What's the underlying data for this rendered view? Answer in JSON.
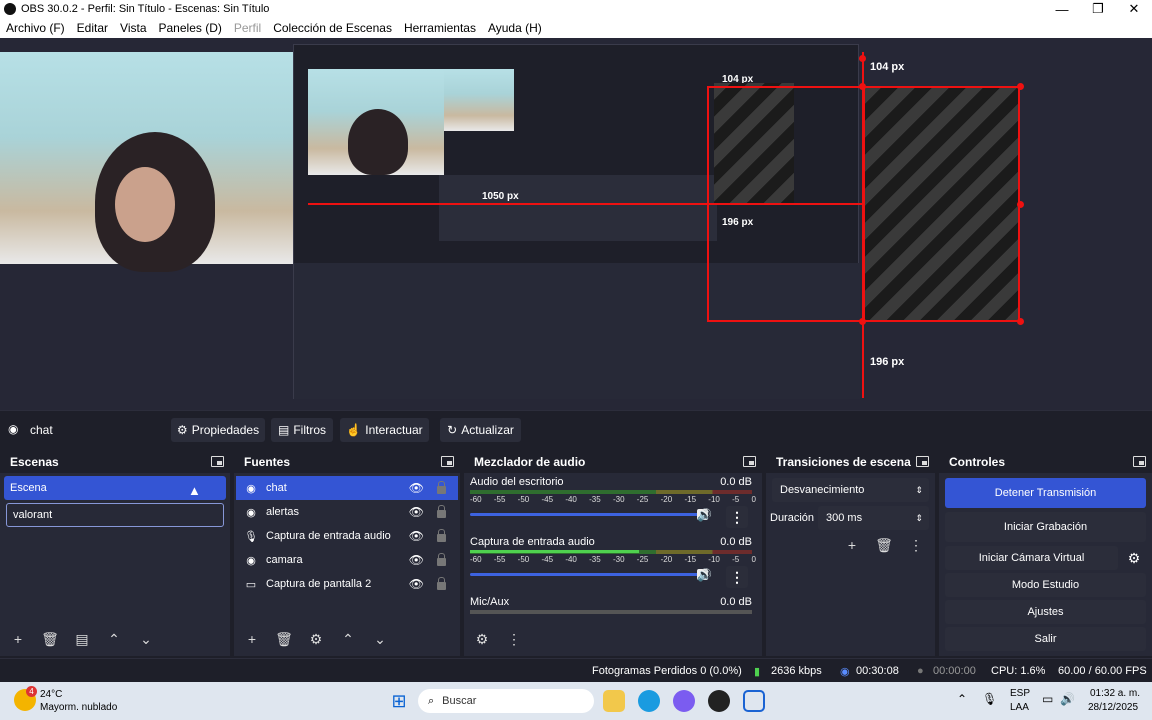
{
  "titlebar": {
    "title": "OBS 30.0.2 - Perfil: Sin Título - Escenas: Sin Título",
    "minimize": "—",
    "maximize": "❐",
    "close": "✕"
  },
  "menu": {
    "items": [
      "Archivo (F)",
      "Editar",
      "Vista",
      "Paneles (D)",
      "Perfil",
      "Colección de Escenas",
      "Herramientas",
      "Ayuda (H)"
    ]
  },
  "preview": {
    "label_top": "104 px",
    "label_right": "196 px",
    "nested_label": "1050 px",
    "nested_label2": "196 px",
    "nested_label3": "104 px"
  },
  "source_toolbar": {
    "current_source": "chat",
    "properties": "Propiedades",
    "filters": "Filtros",
    "interact": "Interactuar",
    "refresh": "Actualizar"
  },
  "scenes": {
    "title": "Escenas",
    "items": [
      "Escena",
      "valorant"
    ]
  },
  "sources": {
    "title": "Fuentes",
    "items": [
      {
        "name": "chat",
        "icon": "browser-icon"
      },
      {
        "name": "alertas",
        "icon": "browser-icon"
      },
      {
        "name": "Captura de entrada audio",
        "icon": "mic-icon"
      },
      {
        "name": "camara",
        "icon": "browser-icon"
      },
      {
        "name": "Captura de pantalla 2",
        "icon": "monitor-icon"
      }
    ]
  },
  "mixer": {
    "title": "Mezclador de audio",
    "scale": [
      "-60",
      "-55",
      "-50",
      "-45",
      "-40",
      "-35",
      "-30",
      "-25",
      "-20",
      "-15",
      "-10",
      "-5",
      "0"
    ],
    "channels": [
      {
        "name": "Audio del escritorio",
        "db": "0.0 dB"
      },
      {
        "name": "Captura de entrada audio",
        "db": "0.0 dB"
      },
      {
        "name": "Mic/Aux",
        "db": "0.0 dB"
      }
    ]
  },
  "transitions": {
    "title": "Transiciones de escena",
    "selected": "Desvanecimiento",
    "duration_label": "Duración",
    "duration_value": "300 ms"
  },
  "controls": {
    "title": "Controles",
    "stop_stream": "Detener Transmisión",
    "start_recording": "Iniciar Grabación",
    "start_virtual_cam": "Iniciar Cámara Virtual",
    "studio_mode": "Modo Estudio",
    "settings": "Ajustes",
    "exit": "Salir"
  },
  "status": {
    "dropped_frames": "Fotogramas Perdidos 0 (0.0%)",
    "bitrate": "2636 kbps",
    "stream_time": "00:30:08",
    "record_time": "00:00:00",
    "cpu": "CPU: 1.6%",
    "fps": "60.00 / 60.00 FPS"
  },
  "taskbar": {
    "weather_temp": "24°C",
    "weather_desc": "Mayorm. nublado",
    "weather_badge": "4",
    "search_placeholder": "Buscar",
    "lang_top": "ESP",
    "lang_bottom": "LAA",
    "time": "01:32 a. m.",
    "date": "28/12/2025"
  },
  "colors": {
    "accent": "#3455d4",
    "dock_bg": "#272937",
    "window_bg": "#1e1f29",
    "red_guide": "#ee1111"
  }
}
